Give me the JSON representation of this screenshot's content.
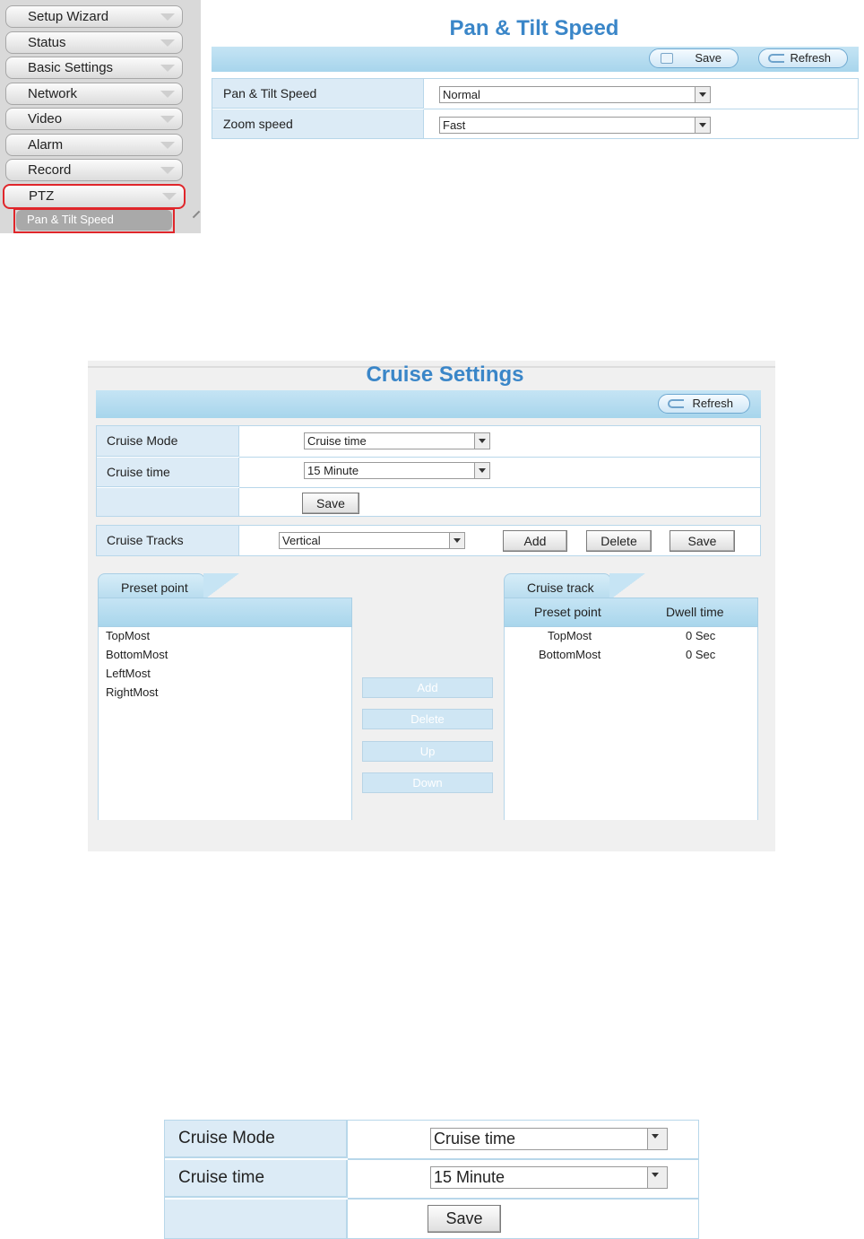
{
  "panel1": {
    "sidebar": {
      "items": [
        "Setup Wizard",
        "Status",
        "Basic Settings",
        "Network",
        "Video",
        "Alarm",
        "Record",
        "PTZ"
      ],
      "active_sub": "Pan & Tilt Speed"
    },
    "title": "Pan & Tilt Speed",
    "save_label": "Save",
    "refresh_label": "Refresh",
    "rows": [
      {
        "label": "Pan & Tilt Speed",
        "value": "Normal"
      },
      {
        "label": "Zoom speed",
        "value": "Fast"
      }
    ]
  },
  "panel2": {
    "title": "Cruise Settings",
    "refresh_label": "Refresh",
    "cruise_mode_label": "Cruise Mode",
    "cruise_mode_value": "Cruise time",
    "cruise_time_label": "Cruise time",
    "cruise_time_value": "15 Minute",
    "save_label": "Save",
    "tracks_label": "Cruise Tracks",
    "tracks_value": "Vertical",
    "add_label": "Add",
    "delete_label": "Delete",
    "tracks_save_label": "Save",
    "preset_tab": "Preset point",
    "preset_items": [
      "TopMost",
      "BottomMost",
      "LeftMost",
      "RightMost"
    ],
    "mid_buttons": [
      "Add",
      "Delete",
      "Up",
      "Down"
    ],
    "track_tab": "Cruise track",
    "track_col1": "Preset point",
    "track_col2": "Dwell time",
    "track_rows": [
      {
        "point": "TopMost",
        "dwell": "0 Sec"
      },
      {
        "point": "BottomMost",
        "dwell": "0 Sec"
      }
    ]
  },
  "panel3": {
    "cruise_mode_label": "Cruise Mode",
    "cruise_mode_value": "Cruise time",
    "cruise_time_label": "Cruise time",
    "cruise_time_value": "15 Minute",
    "save_label": "Save"
  }
}
